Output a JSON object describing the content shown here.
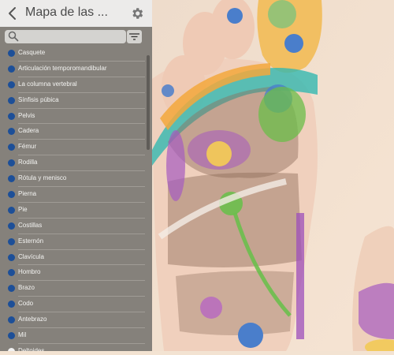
{
  "header": {
    "title": "Mapa de las ..."
  },
  "search": {
    "placeholder": ""
  },
  "list": [
    {
      "label": "Casquete",
      "dot": "#1d4f98"
    },
    {
      "label": "Articulación temporomandibular",
      "dot": "#1d4f98"
    },
    {
      "label": "La columna vertebral",
      "dot": "#1d4f98"
    },
    {
      "label": "Sínfisis púbica",
      "dot": "#1d4f98"
    },
    {
      "label": "Pelvis",
      "dot": "#1d4f98"
    },
    {
      "label": "Cadera",
      "dot": "#1d4f98"
    },
    {
      "label": "Fémur",
      "dot": "#1d4f98"
    },
    {
      "label": "Rodilla",
      "dot": "#1d4f98"
    },
    {
      "label": "Rótula y menisco",
      "dot": "#1d4f98"
    },
    {
      "label": "Pierna",
      "dot": "#1d4f98"
    },
    {
      "label": "Pie",
      "dot": "#1d4f98"
    },
    {
      "label": "Costillas",
      "dot": "#1d4f98"
    },
    {
      "label": "Esternón",
      "dot": "#1d4f98"
    },
    {
      "label": "Clavícula",
      "dot": "#1d4f98"
    },
    {
      "label": "Hombro",
      "dot": "#1d4f98"
    },
    {
      "label": "Brazo",
      "dot": "#1d4f98"
    },
    {
      "label": "Codo",
      "dot": "#1d4f98"
    },
    {
      "label": "Antebrazo",
      "dot": "#1d4f98"
    },
    {
      "label": "Mil",
      "dot": "#1d4f98"
    },
    {
      "label": "Deltoides",
      "dot": "#f2f2f2"
    }
  ],
  "colors": {
    "sidebar_bg": "#85817b",
    "header_bg": "#ecebea",
    "list_dot_blue": "#1d4f98",
    "skin": "#f0d6c0",
    "zone_blue": "#4b7dcc",
    "zone_teal": "#2fb7b0",
    "zone_green": "#73c04f",
    "zone_purple": "#a84fc1",
    "zone_orange": "#f0a23a",
    "zone_yellow": "#f2cf5a",
    "zone_brown": "#8a6a55"
  },
  "icons": {
    "back": "chevron-left-icon",
    "settings": "gear-icon",
    "search": "search-icon",
    "filter": "filter-icon",
    "collapse": "chevron-left-icon"
  }
}
